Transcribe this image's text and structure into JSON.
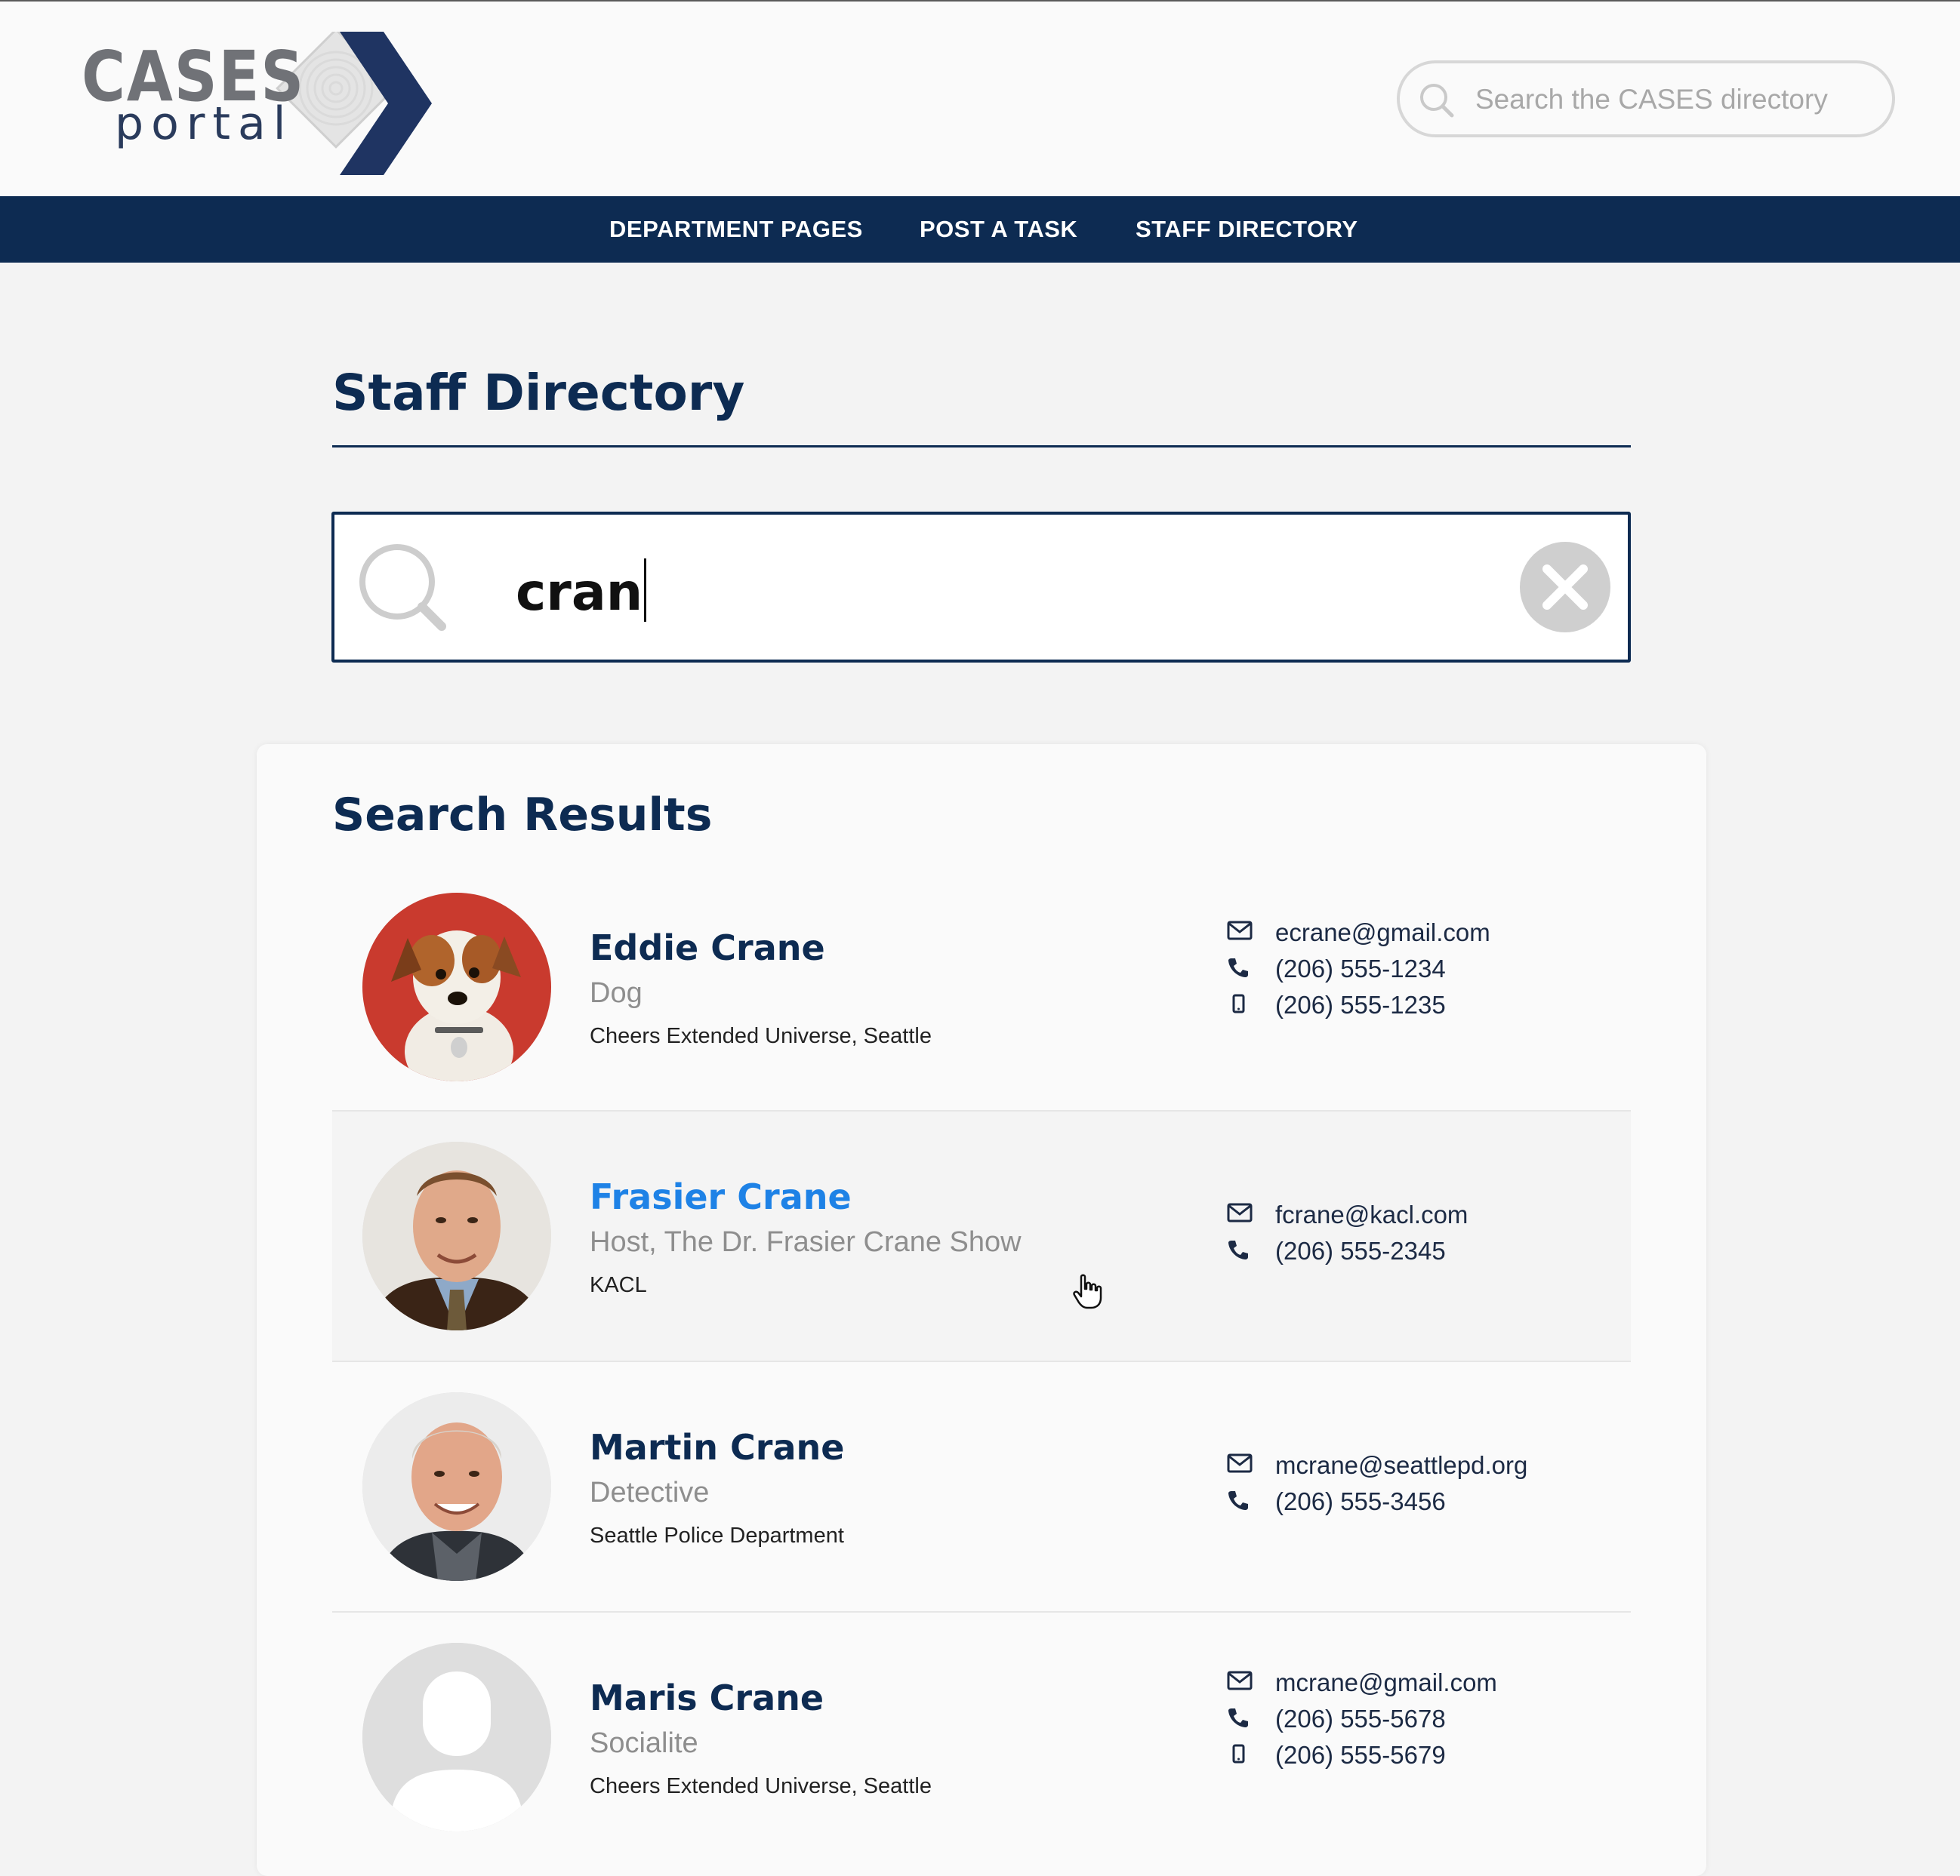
{
  "brand": {
    "line1": "CASES",
    "line2": "portal"
  },
  "header_search": {
    "placeholder": "Search the CASES directory"
  },
  "nav": {
    "items": [
      "DEPARTMENT PAGES",
      "POST A TASK",
      "STAFF DIRECTORY"
    ]
  },
  "page": {
    "title": "Staff Directory"
  },
  "directory_search": {
    "value": "cran"
  },
  "results": {
    "title": "Search Results",
    "people": [
      {
        "name": "Eddie Crane",
        "role": "Dog",
        "org": "Cheers Extended Universe, Seattle",
        "email": "ecrane@gmail.com",
        "phone": "(206) 555-1234",
        "mobile": "(206) 555-1235",
        "avatar": "dog-photo"
      },
      {
        "name": "Frasier Crane",
        "role": "Host, The Dr. Frasier Crane Show",
        "org": "KACL",
        "email": "fcrane@kacl.com",
        "phone": "(206) 555-2345",
        "avatar": "man-suit-photo"
      },
      {
        "name": "Martin Crane",
        "role": "Detective",
        "org": "Seattle Police Department",
        "email": "mcrane@seattlepd.org",
        "phone": "(206) 555-3456",
        "avatar": "older-man-photo"
      },
      {
        "name": "Maris Crane",
        "role": "Socialite",
        "org": "Cheers Extended Universe, Seattle",
        "email": "mcrane@gmail.com",
        "phone": "(206) 555-5678",
        "mobile": "(206) 555-5679",
        "avatar": "placeholder-person"
      }
    ]
  },
  "colors": {
    "navy": "#0d2b52",
    "link_blue": "#1e82e6",
    "muted": "#8e8e8e",
    "page_bg": "#f3f3f3"
  }
}
